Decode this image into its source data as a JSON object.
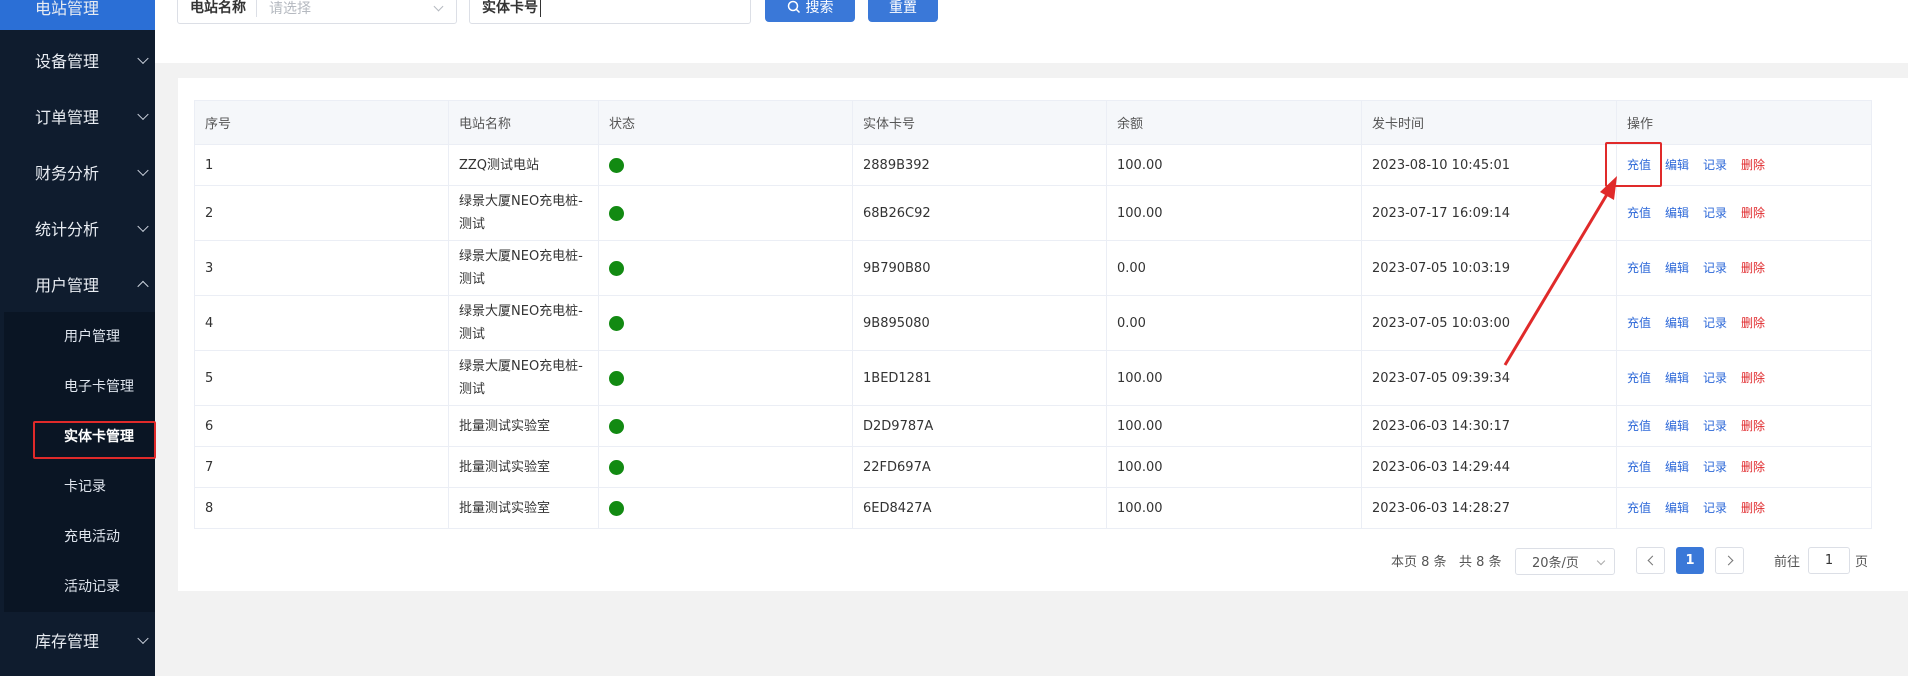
{
  "sidebar": {
    "menu": [
      {
        "label": "电站管理"
      },
      {
        "label": "设备管理"
      },
      {
        "label": "订单管理"
      },
      {
        "label": "财务分析"
      },
      {
        "label": "统计分析"
      },
      {
        "label": "用户管理"
      },
      {
        "label": "库存管理"
      }
    ],
    "submenu": [
      {
        "label": "用户管理"
      },
      {
        "label": "电子卡管理"
      },
      {
        "label": "实体卡管理"
      },
      {
        "label": "卡记录"
      },
      {
        "label": "充电活动"
      },
      {
        "label": "活动记录"
      }
    ],
    "active_sub": "实体卡管理"
  },
  "filters": {
    "station": {
      "label": "电站名称",
      "placeholder": "请选择"
    },
    "card": {
      "label": "实体卡号",
      "value": ""
    },
    "search_button": "搜索",
    "reset_button": "重置"
  },
  "table": {
    "headers": [
      "序号",
      "电站名称",
      "状态",
      "实体卡号",
      "余额",
      "发卡时间",
      "操作"
    ],
    "actions": {
      "recharge": "充值",
      "edit": "编辑",
      "record": "记录",
      "delete": "删除"
    },
    "status_color": "#128a12",
    "rows": [
      {
        "no": "1",
        "station": "ZZQ测试电站",
        "card": "2889B392",
        "balance": "100.00",
        "time": "2023-08-10 10:45:01"
      },
      {
        "no": "2",
        "station": "绿景大厦NEO充电桩-测试",
        "card": "68B26C92",
        "balance": "100.00",
        "time": "2023-07-17 16:09:14"
      },
      {
        "no": "3",
        "station": "绿景大厦NEO充电桩-测试",
        "card": "9B790B80",
        "balance": "0.00",
        "time": "2023-07-05 10:03:19"
      },
      {
        "no": "4",
        "station": "绿景大厦NEO充电桩-测试",
        "card": "9B895080",
        "balance": "0.00",
        "time": "2023-07-05 10:03:00"
      },
      {
        "no": "5",
        "station": "绿景大厦NEO充电桩-测试",
        "card": "1BED1281",
        "balance": "100.00",
        "time": "2023-07-05 09:39:34"
      },
      {
        "no": "6",
        "station": "批量测试实验室",
        "card": "D2D9787A",
        "balance": "100.00",
        "time": "2023-06-03 14:30:17"
      },
      {
        "no": "7",
        "station": "批量测试实验室",
        "card": "22FD697A",
        "balance": "100.00",
        "time": "2023-06-03 14:29:44"
      },
      {
        "no": "8",
        "station": "批量测试实验室",
        "card": "6ED8427A",
        "balance": "100.00",
        "time": "2023-06-03 14:28:27"
      }
    ]
  },
  "pagination": {
    "page_count_text": "本页 8 条",
    "total_text": "共 8 条",
    "page_size": "20条/页",
    "current_page": "1",
    "goto_prefix": "前往",
    "goto_value": "1",
    "goto_suffix": "页"
  }
}
